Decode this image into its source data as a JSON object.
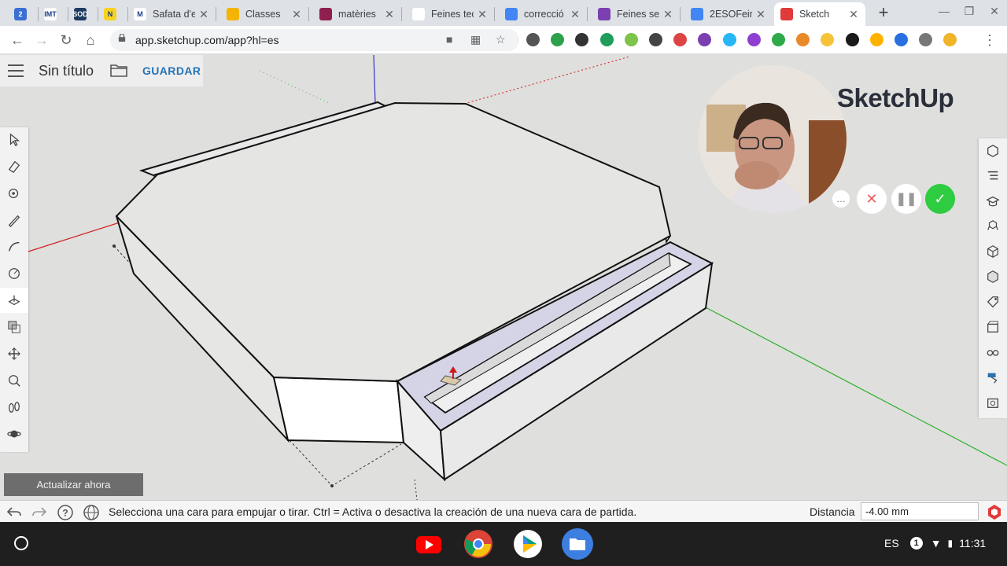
{
  "browser": {
    "tabs": [
      {
        "label": "",
        "fav_text": "2",
        "fav_color": "#3b6fd4"
      },
      {
        "label": "",
        "fav_text": "IMT",
        "fav_color": "#ffffff"
      },
      {
        "label": "",
        "fav_text": "SOD",
        "fav_color": "#1f3a60"
      },
      {
        "label": "",
        "fav_text": "N",
        "fav_color": "#f7d21e"
      },
      {
        "label": "Safata d'e",
        "fav_text": "M",
        "fav_color": "#ffffff"
      },
      {
        "label": "Classes",
        "fav_text": "",
        "fav_color": "#f4b400"
      },
      {
        "label": "matèries",
        "fav_text": "",
        "fav_color": "#8e1f4f"
      },
      {
        "label": "Feines tec",
        "fav_text": "",
        "fav_color": "#ffffff"
      },
      {
        "label": "correcció",
        "fav_text": "",
        "fav_color": "#4285f4"
      },
      {
        "label": "Feines se",
        "fav_text": "",
        "fav_color": "#7b3fb0"
      },
      {
        "label": "2ESOFein",
        "fav_text": "",
        "fav_color": "#4285f4"
      },
      {
        "label": "Sketch",
        "fav_text": "",
        "fav_color": "#e03a3a"
      }
    ],
    "new_tab_label": "+",
    "url": "app.sketchup.com/app?hl=es"
  },
  "sketchup": {
    "doc_title": "Sin título",
    "save_label": "GUARDAR",
    "brand": "SketchUp",
    "update_label": "Actualizar ahora",
    "status_message": "Selecciona una cara para empujar o tirar. Ctrl = Activa o desactiva la creación de una nueva cara de partida.",
    "distance_label": "Distancia",
    "distance_value": "-4.00 mm"
  },
  "shelf": {
    "lang": "ES",
    "notification_count": "1",
    "time": "11:31"
  },
  "colors": {
    "accent": "#2773b4",
    "record_ok": "#2ecc40",
    "record_cancel": "#e85c5c"
  }
}
